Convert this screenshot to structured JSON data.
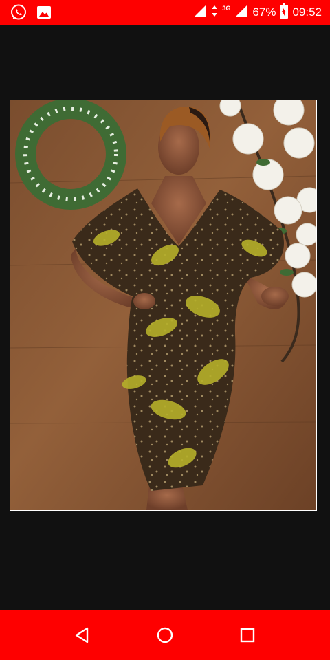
{
  "status_bar": {
    "battery_percent": "67%",
    "time": "09:52",
    "network_type": "3G",
    "left_icons": [
      "whatsapp-icon",
      "gallery-icon"
    ],
    "right_icons": [
      "signal-icon",
      "data-arrows-icon",
      "signal-icon-2",
      "battery-charging-icon"
    ],
    "background_color": "#fe0000"
  },
  "content": {
    "background_color": "#111111"
  },
  "navigation_bar": {
    "buttons": [
      "back-icon",
      "home-icon",
      "recents-icon"
    ],
    "background_color": "#fe0000"
  }
}
